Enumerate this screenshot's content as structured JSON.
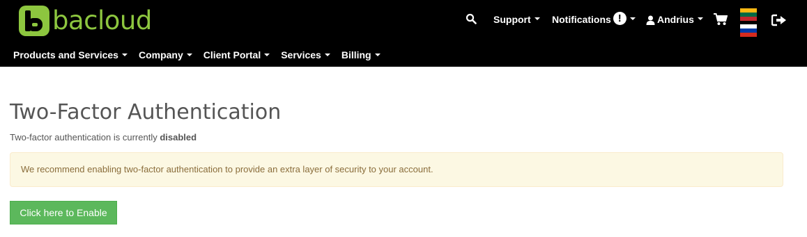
{
  "brand": {
    "logo_text": "bacloud",
    "logo_color": "#8dc63f"
  },
  "topnav": {
    "support_label": "Support",
    "notifications_label": "Notifications",
    "notifications_badge": "!",
    "user_label": "Andrius"
  },
  "icons": {
    "search": "search-icon",
    "cart": "cart-icon",
    "logout": "logout-icon",
    "user": "user-icon",
    "flags": [
      "flag-lithuania",
      "flag-russia"
    ]
  },
  "mainnav": {
    "items": [
      {
        "label": "Products and Services"
      },
      {
        "label": "Company"
      },
      {
        "label": "Client Portal"
      },
      {
        "label": "Services"
      },
      {
        "label": "Billing"
      }
    ]
  },
  "page": {
    "title": "Two-Factor Authentication",
    "status_prefix": "Two-factor authentication is currently ",
    "status_value": "disabled",
    "alert_text": "We recommend enabling two-factor authentication to provide an extra layer of security to your account.",
    "enable_button": "Click here to Enable"
  },
  "colors": {
    "header_bg": "#000000",
    "alert_bg": "#fcf8e3",
    "alert_text": "#8a6d3b",
    "button_bg": "#5cb85c"
  }
}
